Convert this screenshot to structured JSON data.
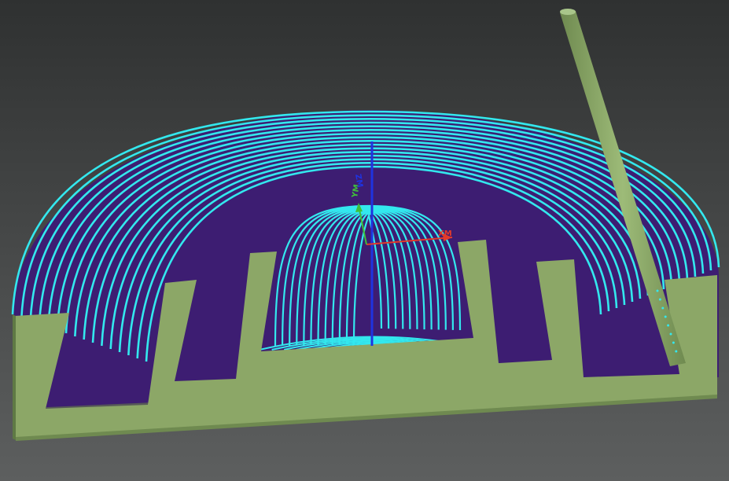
{
  "viewport": {
    "title": "",
    "axes": {
      "x_label": "XM",
      "y_label": "YM",
      "z_label": "ZM"
    }
  },
  "colors": {
    "background_top": "#2f3131",
    "background_bottom": "#5d5f5f",
    "stock": "#8ca767",
    "stock_shadow": "#6f8a50",
    "pocket_floor": "#3d1d72",
    "toolpath": "#33e8ee",
    "axis_x": "#e23a2a",
    "axis_y": "#3fbf3a",
    "axis_z": "#1f33e0",
    "tool": "#8fae6a"
  },
  "icons": {
    "tool": "end-mill-tool-icon",
    "triad": "coordinate-triad-icon"
  }
}
